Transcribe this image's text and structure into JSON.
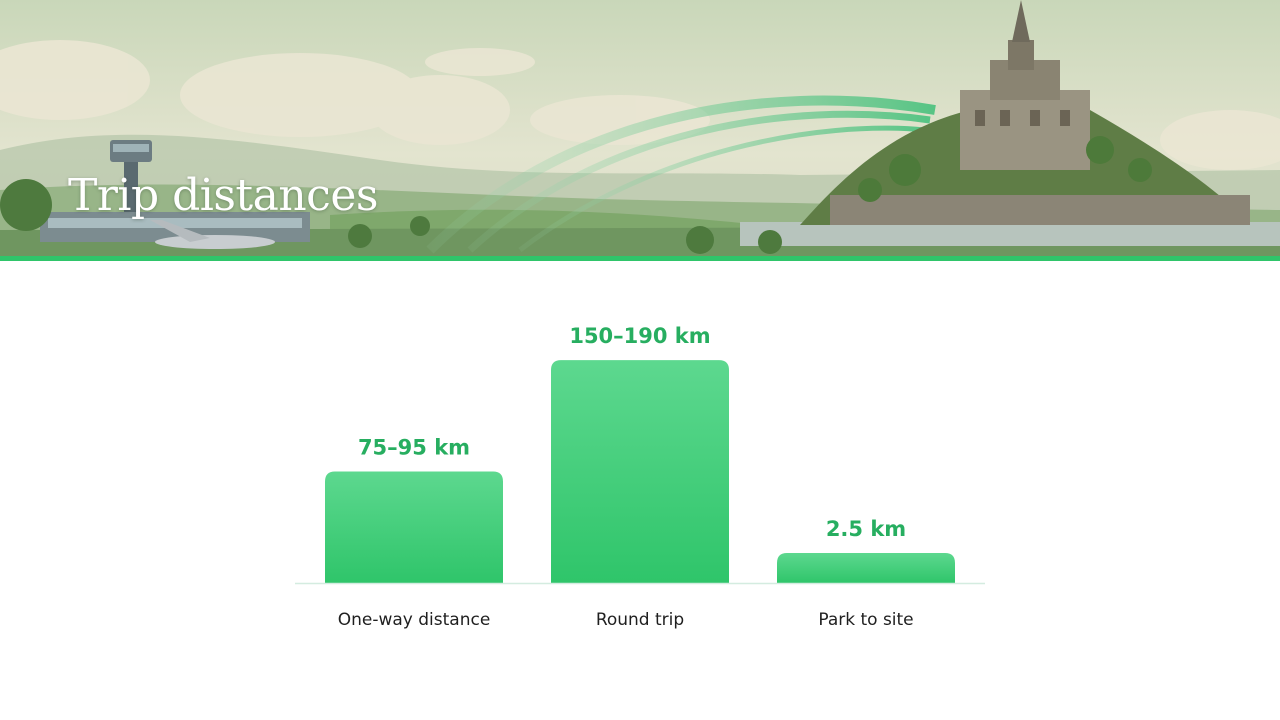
{
  "header": {
    "title": "Trip distances"
  },
  "colors": {
    "accent": "#2fc56a",
    "bar_top": "#5dd88f",
    "bar_bottom": "#2fc56a",
    "value_text": "#27ae60",
    "baseline": "#d4ece0"
  },
  "chart_data": {
    "type": "bar",
    "title": "",
    "xlabel": "",
    "ylabel": "",
    "categories": [
      "One-way distance",
      "Round trip",
      "Park to site"
    ],
    "values": [
      85,
      170,
      2.5
    ],
    "value_labels": [
      "75–95 km",
      "150–190 km",
      "2.5 km"
    ],
    "ylim": [
      0,
      180
    ],
    "grid": false,
    "legend": "none"
  }
}
